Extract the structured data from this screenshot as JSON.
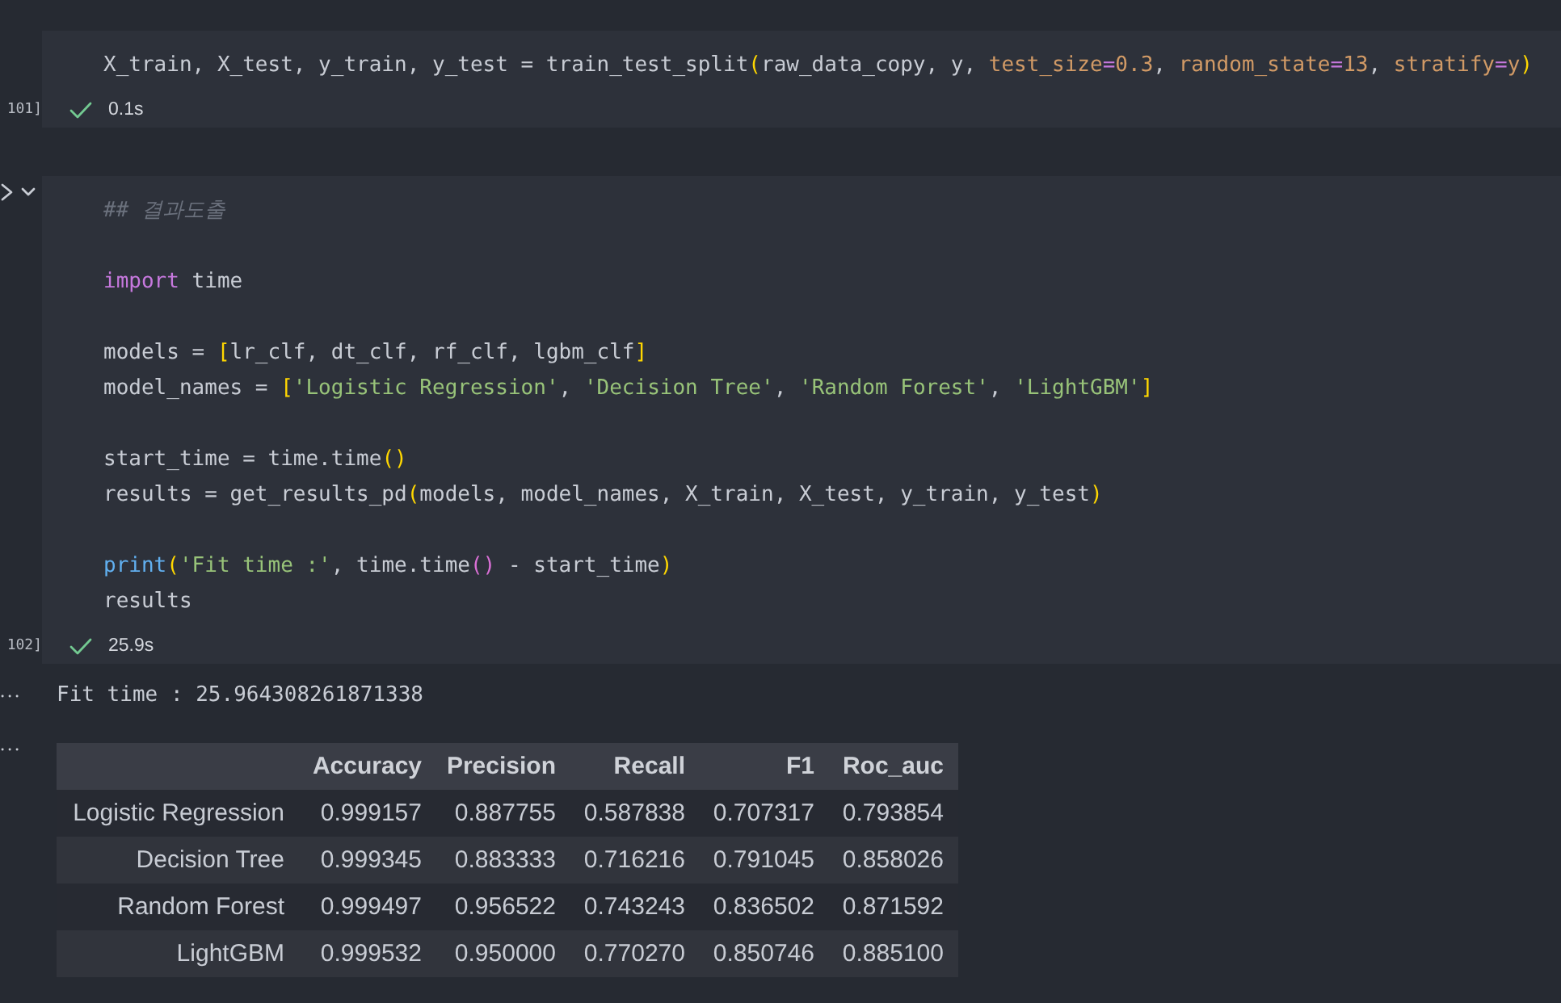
{
  "cells": [
    {
      "count": "101]",
      "collapsible": false,
      "status": {
        "ok": true,
        "duration": "0.1s"
      },
      "blocks": [
        [
          [
            {
              "text": "X_train, X_test, y_train, y_test = train_test_split",
              "kind": "plain"
            },
            {
              "text": "(",
              "kind": "bracket"
            },
            {
              "text": "raw_data_copy, y, ",
              "kind": "plain"
            },
            {
              "text": "test_size",
              "kind": "arg"
            },
            {
              "text": "=",
              "kind": "op"
            },
            {
              "text": "0.3",
              "kind": "arg"
            },
            {
              "text": ", ",
              "kind": "plain"
            },
            {
              "text": "random_state",
              "kind": "arg"
            },
            {
              "text": "=",
              "kind": "op"
            },
            {
              "text": "13",
              "kind": "arg"
            },
            {
              "text": ", ",
              "kind": "plain"
            },
            {
              "text": "stratify",
              "kind": "arg"
            },
            {
              "text": "=",
              "kind": "op"
            },
            {
              "text": "y",
              "kind": "arg"
            },
            {
              "text": ")",
              "kind": "bracket"
            }
          ]
        ]
      ]
    },
    {
      "count": "102]",
      "collapsible": true,
      "status": {
        "ok": true,
        "duration": "25.9s"
      },
      "blocks": [
        [
          [
            {
              "text": "## 결과도출",
              "kind": "comment"
            }
          ]
        ],
        [
          [
            {
              "text": "import",
              "kind": "keyword"
            },
            {
              "text": " time",
              "kind": "plain"
            }
          ]
        ],
        [
          [
            {
              "text": "models = ",
              "kind": "plain"
            },
            {
              "text": "[",
              "kind": "bracket"
            },
            {
              "text": "lr_clf, dt_clf, rf_clf, lgbm_clf",
              "kind": "plain"
            },
            {
              "text": "]",
              "kind": "bracket"
            }
          ],
          [
            {
              "text": "model_names = ",
              "kind": "plain"
            },
            {
              "text": "[",
              "kind": "bracket"
            },
            {
              "text": "'Logistic Regression'",
              "kind": "string"
            },
            {
              "text": ", ",
              "kind": "plain"
            },
            {
              "text": "'Decision Tree'",
              "kind": "string"
            },
            {
              "text": ", ",
              "kind": "plain"
            },
            {
              "text": "'Random Forest'",
              "kind": "string"
            },
            {
              "text": ", ",
              "kind": "plain"
            },
            {
              "text": "'LightGBM'",
              "kind": "string"
            },
            {
              "text": "]",
              "kind": "bracket"
            }
          ]
        ],
        [
          [
            {
              "text": "start_time = time.time",
              "kind": "plain"
            },
            {
              "text": "()",
              "kind": "bracket"
            }
          ],
          [
            {
              "text": "results = get_results_pd",
              "kind": "plain"
            },
            {
              "text": "(",
              "kind": "bracket"
            },
            {
              "text": "models, model_names, X_train, X_test, y_train, y_test",
              "kind": "plain"
            },
            {
              "text": ")",
              "kind": "bracket"
            }
          ]
        ],
        [
          [
            {
              "text": "print",
              "kind": "function"
            },
            {
              "text": "(",
              "kind": "bracket"
            },
            {
              "text": "'Fit time :'",
              "kind": "string"
            },
            {
              "text": ", time.time",
              "kind": "plain"
            },
            {
              "text": "()",
              "kind": "bracket2"
            },
            {
              "text": " - start_time",
              "kind": "plain"
            },
            {
              "text": ")",
              "kind": "bracket"
            }
          ],
          [
            {
              "text": "results",
              "kind": "plain"
            }
          ]
        ]
      ],
      "outputs": [
        {
          "kind": "stream",
          "text": "Fit time : 25.964308261871338"
        },
        {
          "kind": "table",
          "columns": [
            "Accuracy",
            "Precision",
            "Recall",
            "F1",
            "Roc_auc"
          ],
          "rows": [
            {
              "label": "Logistic Regression",
              "cells": [
                "0.999157",
                "0.887755",
                "0.587838",
                "0.707317",
                "0.793854"
              ]
            },
            {
              "label": "Decision Tree",
              "cells": [
                "0.999345",
                "0.883333",
                "0.716216",
                "0.791045",
                "0.858026"
              ]
            },
            {
              "label": "Random Forest",
              "cells": [
                "0.999497",
                "0.956522",
                "0.743243",
                "0.836502",
                "0.871592"
              ]
            },
            {
              "label": "LightGBM",
              "cells": [
                "0.999532",
                "0.950000",
                "0.770270",
                "0.850746",
                "0.885100"
              ]
            }
          ]
        }
      ]
    }
  ]
}
